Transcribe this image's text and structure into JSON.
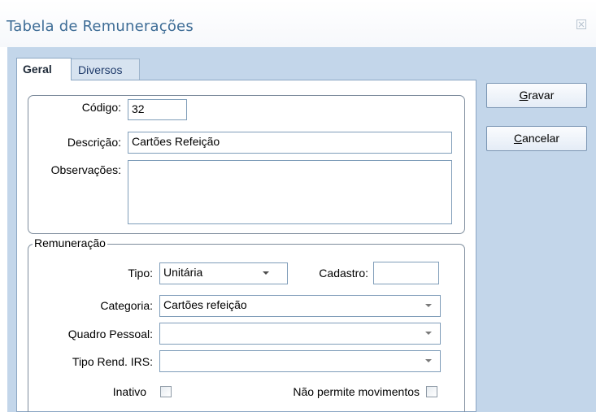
{
  "window": {
    "title": "Tabela de Remunerações",
    "close_icon": "close-icon"
  },
  "tabs": [
    {
      "label": "Geral",
      "active": true
    },
    {
      "label": "Diversos",
      "active": false
    }
  ],
  "buttons": {
    "save": {
      "first": "G",
      "rest": "ravar"
    },
    "cancel": {
      "first": "C",
      "rest": "ancelar"
    }
  },
  "general": {
    "codigo_label": "Código:",
    "codigo_value": "32",
    "descricao_label": "Descrição:",
    "descricao_value": "Cartões Refeição",
    "observacoes_label": "Observações:",
    "observacoes_value": ""
  },
  "remuneracao": {
    "legend": "Remuneração",
    "tipo_label": "Tipo:",
    "tipo_value": "Unitária",
    "cadastro_label": "Cadastro:",
    "cadastro_value": "",
    "categoria_label": "Categoria:",
    "categoria_value": "Cartões refeição",
    "quadro_label": "Quadro Pessoal:",
    "quadro_value": "",
    "tipo_rend_label": "Tipo Rend. IRS:",
    "tipo_rend_value": "",
    "inativo_label": "Inativo",
    "inativo_checked": false,
    "nao_permite_label": "Não permite movimentos",
    "nao_permite_checked": false
  },
  "colors": {
    "title_text": "#3e6d96",
    "frame_bg": "#c3d6ea",
    "field_border": "#7f9db9"
  }
}
